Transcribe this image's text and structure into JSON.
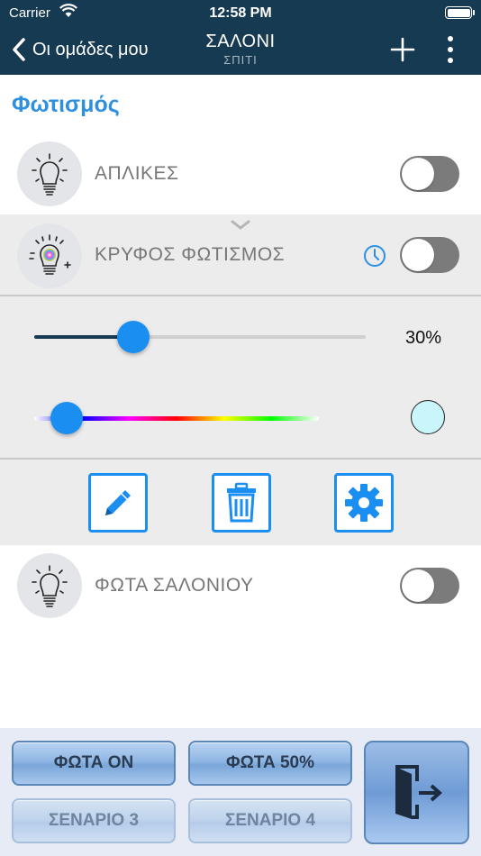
{
  "status_bar": {
    "carrier": "Carrier",
    "time": "12:58 PM"
  },
  "nav": {
    "back_label": "Οι ομάδες μου",
    "title": "ΣΑΛΟΝΙ",
    "subtitle": "ΣΠΙΤΙ"
  },
  "section": {
    "title": "Φωτισμός"
  },
  "devices": [
    {
      "label": "ΑΠΛΙΚΕΣ",
      "on": false
    },
    {
      "label": "ΚΡΥΦΟΣ ΦΩΤΙΣΜΟΣ",
      "on": false,
      "brightness_percent": 30,
      "brightness_label": "30%",
      "color_position": 0.05,
      "selected_color": "#c8f6fb"
    },
    {
      "label": "ΦΩΤΑ ΣΑΛΟΝΙΟΥ",
      "on": false
    }
  ],
  "scenes": [
    {
      "label": "ΦΩΤΑ ON",
      "enabled": true
    },
    {
      "label": "ΦΩΤΑ 50%",
      "enabled": true
    },
    {
      "label": "ΣΕΝΑΡΙΟ 3",
      "enabled": false
    },
    {
      "label": "ΣΕΝΑΡΙΟ 4",
      "enabled": false
    }
  ],
  "colors": {
    "header": "#163a52",
    "accent": "#1a8ef1",
    "section_title": "#2f8fe0"
  },
  "icons": [
    "back-chevron-icon",
    "plus-icon",
    "more-vertical-icon",
    "lightbulb-icon",
    "rgb-lightbulb-icon",
    "clock-icon",
    "chevron-down-icon",
    "pencil-icon",
    "trash-icon",
    "gear-icon",
    "exit-door-icon"
  ]
}
